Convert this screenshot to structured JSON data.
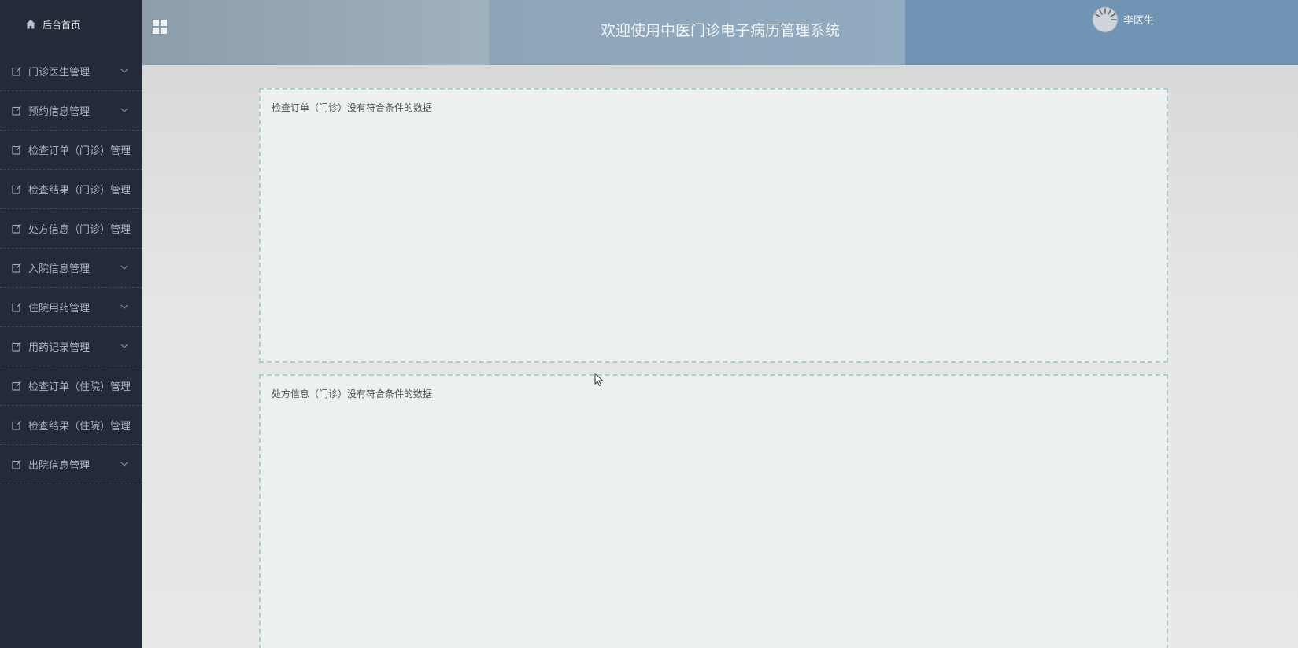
{
  "sidebar": {
    "home_label": "后台首页",
    "items": [
      {
        "label": "门诊医生管理",
        "has_submenu": true
      },
      {
        "label": "预约信息管理",
        "has_submenu": true
      },
      {
        "label": "检查订单（门诊）管理",
        "has_submenu": false
      },
      {
        "label": "检查结果（门诊）管理",
        "has_submenu": false
      },
      {
        "label": "处方信息（门诊）管理",
        "has_submenu": false
      },
      {
        "label": "入院信息管理",
        "has_submenu": true
      },
      {
        "label": "住院用药管理",
        "has_submenu": true
      },
      {
        "label": "用药记录管理",
        "has_submenu": true
      },
      {
        "label": "检查订单（住院）管理",
        "has_submenu": false
      },
      {
        "label": "检查结果（住院）管理",
        "has_submenu": false
      },
      {
        "label": "出院信息管理",
        "has_submenu": true
      }
    ]
  },
  "header": {
    "title": "欢迎使用中医门诊电子病历管理系统",
    "user_name": "李医生",
    "menu_icon": "grid-icon",
    "avatar_icon": "avatar"
  },
  "main": {
    "panels": [
      {
        "text": "检查订单（门诊）没有符合条件的数据"
      },
      {
        "text": "处方信息（门诊）没有符合条件的数据"
      }
    ]
  },
  "colors": {
    "sidebar_bg": "#232a38",
    "panel_border": "#a9cdd2",
    "panel_bg": "#ecf0ef"
  }
}
